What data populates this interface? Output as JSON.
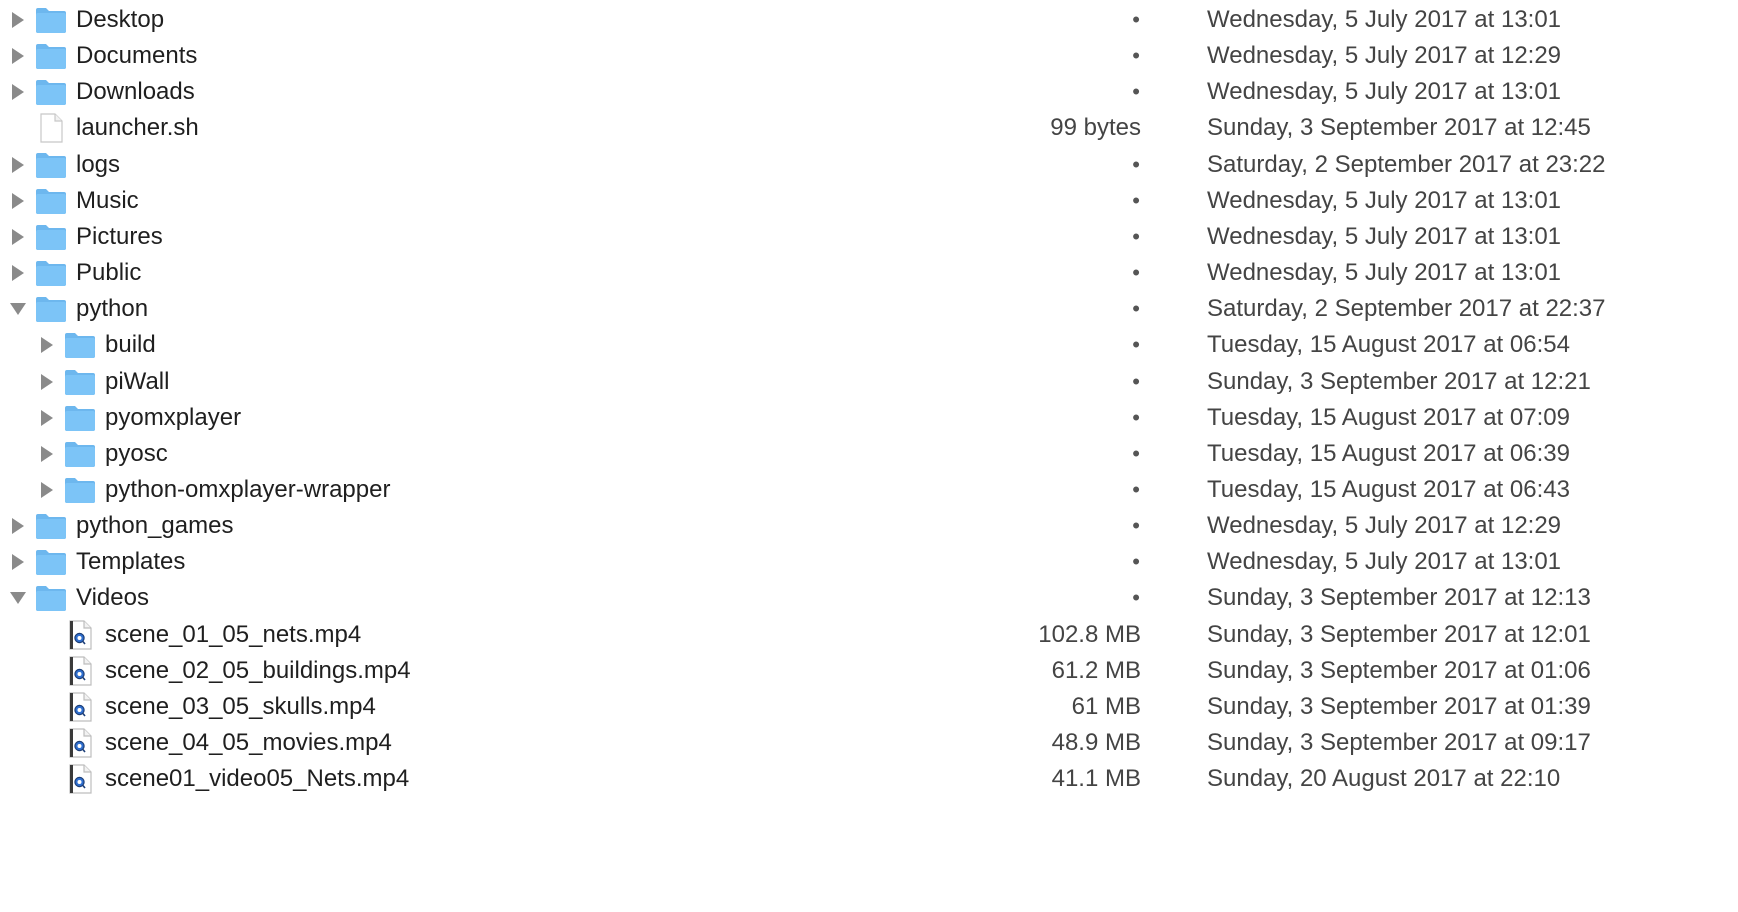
{
  "colors": {
    "folder": "#7cc4f7",
    "folder_tab": "#6db7ee",
    "disclosure": "#8a8a8a",
    "text": "#1f1f1f",
    "secondary_text": "#444444"
  },
  "rows": [
    {
      "name": "Desktop",
      "size": "•",
      "date": "Wednesday, 5 July 2017 at 13:01",
      "kind": "folder",
      "level": 0,
      "disclosure": "collapsed"
    },
    {
      "name": "Documents",
      "size": "•",
      "date": "Wednesday, 5 July 2017 at 12:29",
      "kind": "folder",
      "level": 0,
      "disclosure": "collapsed"
    },
    {
      "name": "Downloads",
      "size": "•",
      "date": "Wednesday, 5 July 2017 at 13:01",
      "kind": "folder",
      "level": 0,
      "disclosure": "collapsed"
    },
    {
      "name": "launcher.sh",
      "size": "99 bytes",
      "date": "Sunday, 3 September 2017 at 12:45",
      "kind": "file",
      "level": 0,
      "disclosure": "none"
    },
    {
      "name": "logs",
      "size": "•",
      "date": "Saturday, 2 September 2017 at 23:22",
      "kind": "folder",
      "level": 0,
      "disclosure": "collapsed"
    },
    {
      "name": "Music",
      "size": "•",
      "date": "Wednesday, 5 July 2017 at 13:01",
      "kind": "folder",
      "level": 0,
      "disclosure": "collapsed"
    },
    {
      "name": "Pictures",
      "size": "•",
      "date": "Wednesday, 5 July 2017 at 13:01",
      "kind": "folder",
      "level": 0,
      "disclosure": "collapsed"
    },
    {
      "name": "Public",
      "size": "•",
      "date": "Wednesday, 5 July 2017 at 13:01",
      "kind": "folder",
      "level": 0,
      "disclosure": "collapsed"
    },
    {
      "name": "python",
      "size": "•",
      "date": "Saturday, 2 September 2017 at 22:37",
      "kind": "folder",
      "level": 0,
      "disclosure": "expanded"
    },
    {
      "name": "build",
      "size": "•",
      "date": "Tuesday, 15 August 2017 at 06:54",
      "kind": "folder",
      "level": 1,
      "disclosure": "collapsed"
    },
    {
      "name": "piWall",
      "size": "•",
      "date": "Sunday, 3 September 2017 at 12:21",
      "kind": "folder",
      "level": 1,
      "disclosure": "collapsed"
    },
    {
      "name": "pyomxplayer",
      "size": "•",
      "date": "Tuesday, 15 August 2017 at 07:09",
      "kind": "folder",
      "level": 1,
      "disclosure": "collapsed"
    },
    {
      "name": "pyosc",
      "size": "•",
      "date": "Tuesday, 15 August 2017 at 06:39",
      "kind": "folder",
      "level": 1,
      "disclosure": "collapsed"
    },
    {
      "name": "python-omxplayer-wrapper",
      "size": "•",
      "date": "Tuesday, 15 August 2017 at 06:43",
      "kind": "folder",
      "level": 1,
      "disclosure": "collapsed"
    },
    {
      "name": "python_games",
      "size": "•",
      "date": "Wednesday, 5 July 2017 at 12:29",
      "kind": "folder",
      "level": 0,
      "disclosure": "collapsed"
    },
    {
      "name": "Templates",
      "size": "•",
      "date": "Wednesday, 5 July 2017 at 13:01",
      "kind": "folder",
      "level": 0,
      "disclosure": "collapsed"
    },
    {
      "name": "Videos",
      "size": "•",
      "date": "Sunday, 3 September 2017 at 12:13",
      "kind": "folder",
      "level": 0,
      "disclosure": "expanded"
    },
    {
      "name": "scene_01_05_nets.mp4",
      "size": "102.8 MB",
      "date": "Sunday, 3 September 2017 at 12:01",
      "kind": "video",
      "level": 1,
      "disclosure": "none"
    },
    {
      "name": "scene_02_05_buildings.mp4",
      "size": "61.2 MB",
      "date": "Sunday, 3 September 2017 at 01:06",
      "kind": "video",
      "level": 1,
      "disclosure": "none"
    },
    {
      "name": "scene_03_05_skulls.mp4",
      "size": "61 MB",
      "date": "Sunday, 3 September 2017 at 01:39",
      "kind": "video",
      "level": 1,
      "disclosure": "none"
    },
    {
      "name": "scene_04_05_movies.mp4",
      "size": "48.9 MB",
      "date": "Sunday, 3 September 2017 at 09:17",
      "kind": "video",
      "level": 1,
      "disclosure": "none"
    },
    {
      "name": "scene01_video05_Nets.mp4",
      "size": "41.1 MB",
      "date": "Sunday, 20 August 2017 at 22:10",
      "kind": "video",
      "level": 1,
      "disclosure": "none"
    }
  ]
}
